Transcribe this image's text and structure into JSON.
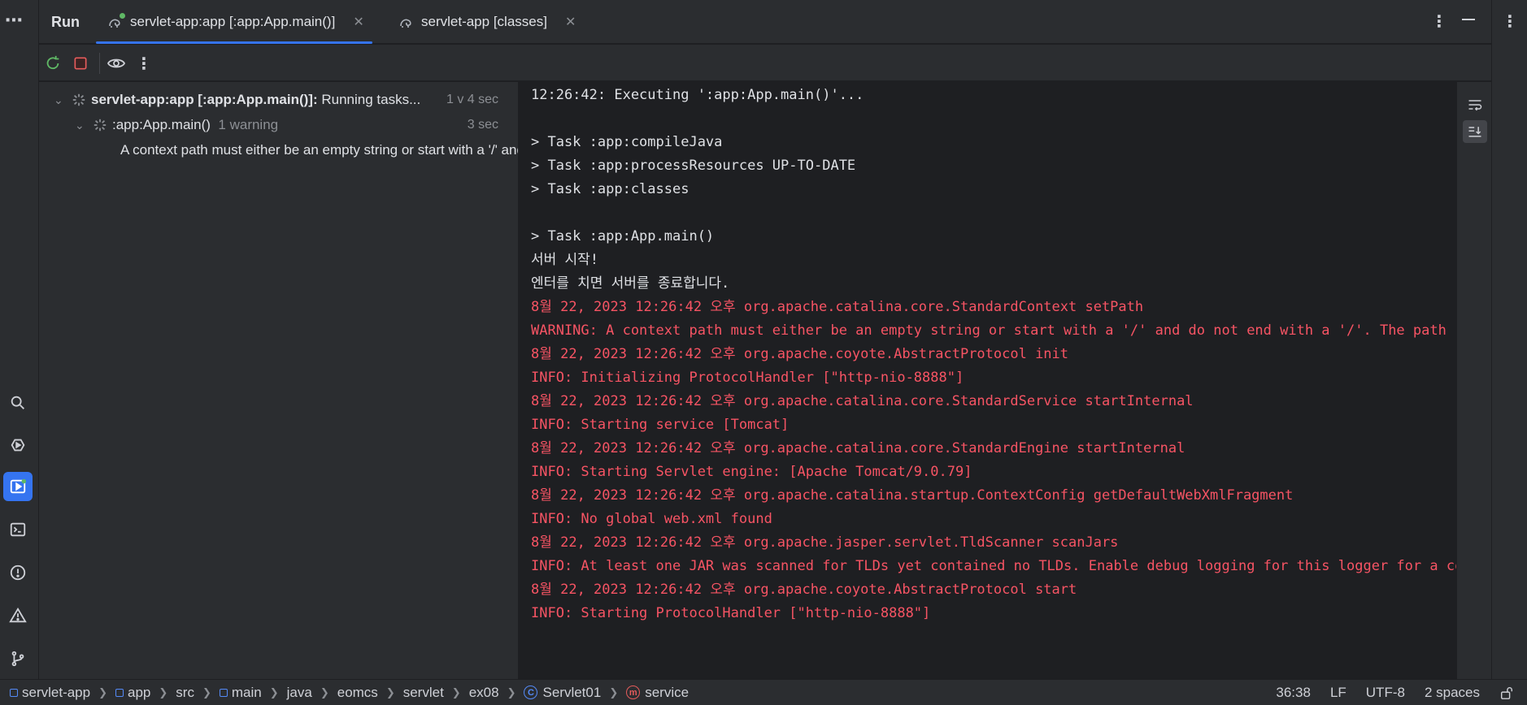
{
  "toolwindow": {
    "title": "Run",
    "tabs": [
      {
        "label": "servlet-app:app [:app:App.main()]",
        "active": true
      },
      {
        "label": "servlet-app [classes]",
        "active": false
      }
    ]
  },
  "toolbar": {
    "icons": [
      "rerun-icon",
      "stop-icon",
      "show-options-icon",
      "more-icon"
    ]
  },
  "tree": {
    "root": {
      "name": "servlet-app:app [:app:App.main()]:",
      "status": "Running tasks...",
      "time": "1 v 4 sec"
    },
    "child": {
      "name": ":app:App.main()",
      "warning_count": "1 warning",
      "time": "3 sec"
    },
    "warning": {
      "text": "A context path must either be an empty string or start with a '/' and do not end with a '/'."
    }
  },
  "console": {
    "lines": [
      {
        "text": "12:26:42: Executing ':app:App.main()'...",
        "type": "normal"
      },
      {
        "text": "",
        "type": "normal"
      },
      {
        "text": "> Task :app:compileJava",
        "type": "normal"
      },
      {
        "text": "> Task :app:processResources UP-TO-DATE",
        "type": "normal"
      },
      {
        "text": "> Task :app:classes",
        "type": "normal"
      },
      {
        "text": "",
        "type": "normal"
      },
      {
        "text": "> Task :app:App.main()",
        "type": "normal"
      },
      {
        "text": "서버 시작!",
        "type": "normal"
      },
      {
        "text": "엔터를 치면 서버를 종료합니다.",
        "type": "normal"
      },
      {
        "text": "8월 22, 2023 12:26:42 오후 org.apache.catalina.core.StandardContext setPath",
        "type": "err"
      },
      {
        "text": "WARNING: A context path must either be an empty string or start with a '/' and do not end with a '/'. The path [/] does not meet these criteria and has been changed to []",
        "type": "err"
      },
      {
        "text": "8월 22, 2023 12:26:42 오후 org.apache.coyote.AbstractProtocol init",
        "type": "err"
      },
      {
        "text": "INFO: Initializing ProtocolHandler [\"http-nio-8888\"]",
        "type": "err"
      },
      {
        "text": "8월 22, 2023 12:26:42 오후 org.apache.catalina.core.StandardService startInternal",
        "type": "err"
      },
      {
        "text": "INFO: Starting service [Tomcat]",
        "type": "err"
      },
      {
        "text": "8월 22, 2023 12:26:42 오후 org.apache.catalina.core.StandardEngine startInternal",
        "type": "err"
      },
      {
        "text": "INFO: Starting Servlet engine: [Apache Tomcat/9.0.79]",
        "type": "err"
      },
      {
        "text": "8월 22, 2023 12:26:42 오후 org.apache.catalina.startup.ContextConfig getDefaultWebXmlFragment",
        "type": "err"
      },
      {
        "text": "INFO: No global web.xml found",
        "type": "err"
      },
      {
        "text": "8월 22, 2023 12:26:42 오후 org.apache.jasper.servlet.TldScanner scanJars",
        "type": "err"
      },
      {
        "text": "INFO: At least one JAR was scanned for TLDs yet contained no TLDs. Enable debug logging for this logger for a complete list of JARs that were scanned but no TLDs were found in them.",
        "type": "err"
      },
      {
        "text": "8월 22, 2023 12:26:42 오후 org.apache.coyote.AbstractProtocol start",
        "type": "err"
      },
      {
        "text": "INFO: Starting ProtocolHandler [\"http-nio-8888\"]",
        "type": "err"
      }
    ]
  },
  "breadcrumbs": [
    {
      "label": "servlet-app",
      "icon": "module-icon"
    },
    {
      "label": "app",
      "icon": "module-icon"
    },
    {
      "label": "src",
      "icon": ""
    },
    {
      "label": "main",
      "icon": "module-icon"
    },
    {
      "label": "java",
      "icon": ""
    },
    {
      "label": "eomcs",
      "icon": ""
    },
    {
      "label": "servlet",
      "icon": ""
    },
    {
      "label": "ex08",
      "icon": ""
    },
    {
      "label": "Servlet01",
      "icon": "class-icon"
    },
    {
      "label": "service",
      "icon": "method-icon"
    }
  ],
  "status": {
    "position": "36:38",
    "line_separator": "LF",
    "encoding": "UTF-8",
    "indent": "2 spaces"
  },
  "colors": {
    "accent": "#3574f0",
    "error_text": "#f75464",
    "running_dot": "#5fb865",
    "warning": "#f2c55c"
  }
}
